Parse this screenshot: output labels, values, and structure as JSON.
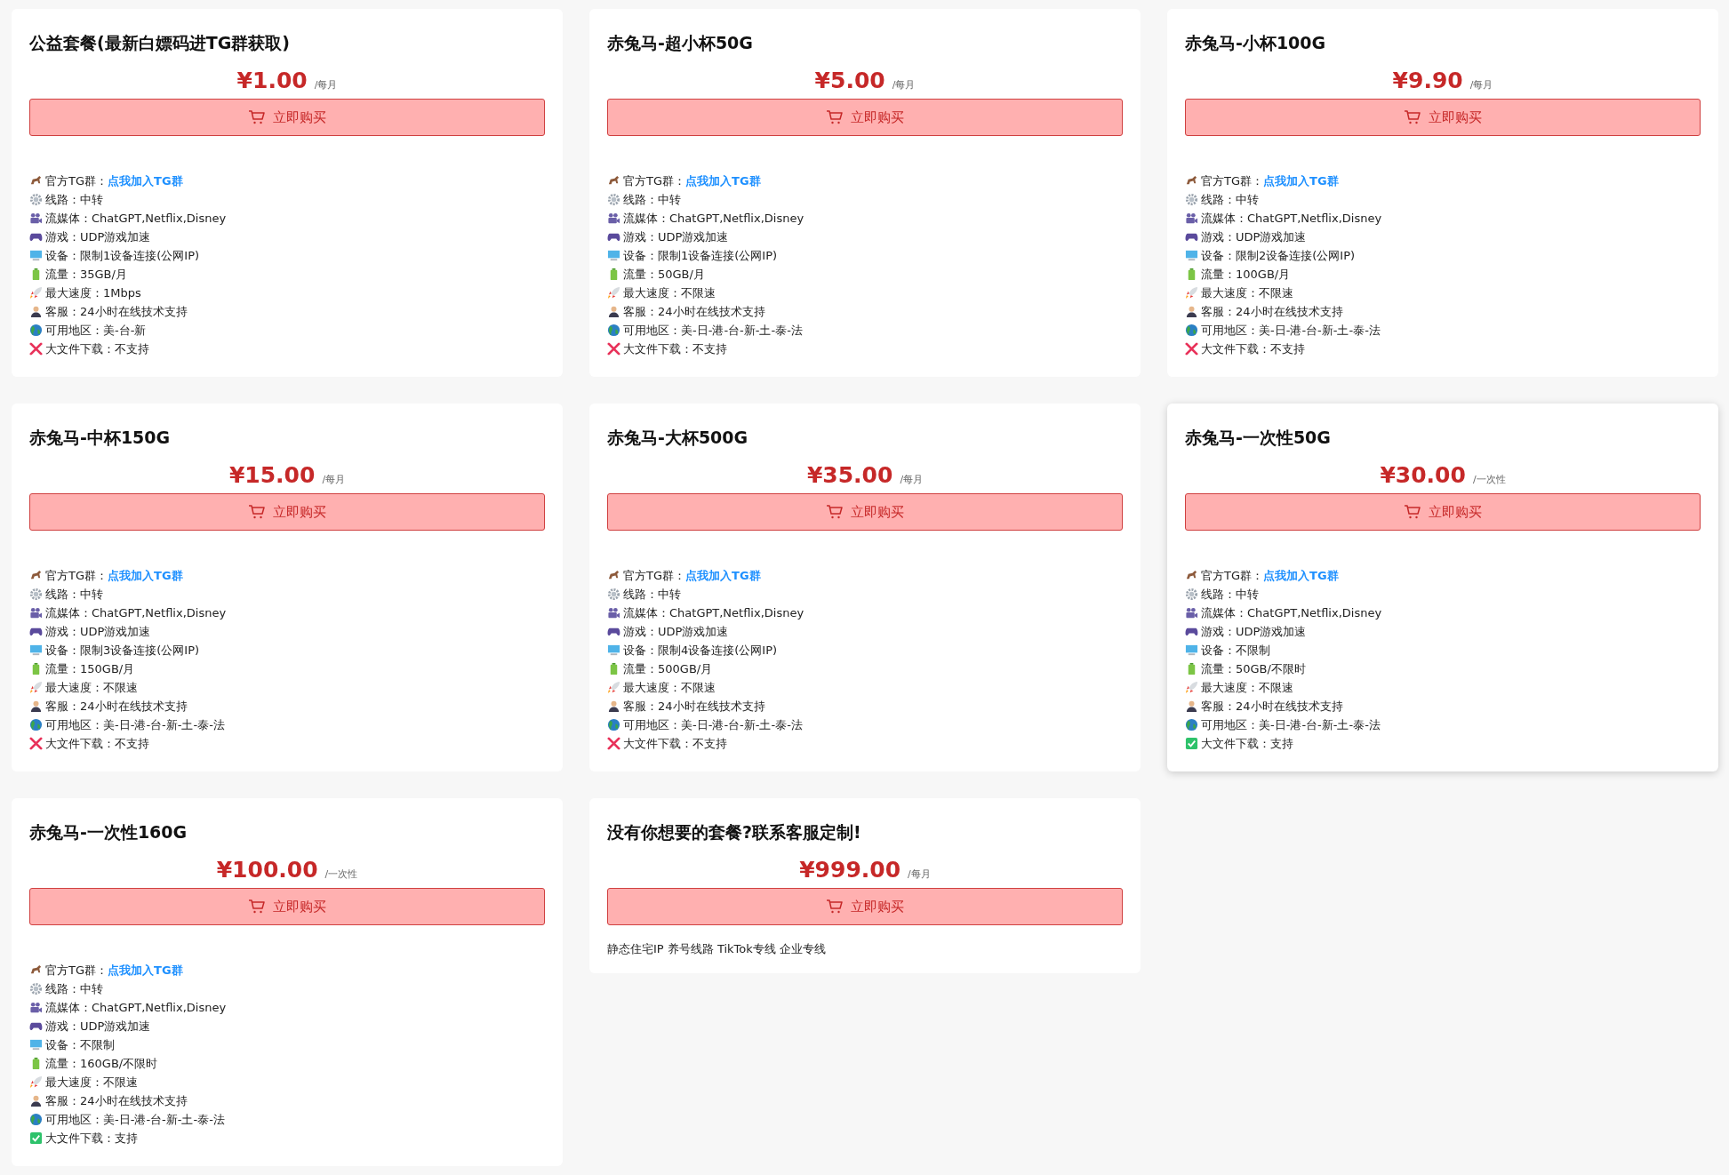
{
  "plans": [
    {
      "title": "公益套餐(最新白嫖码进TG群获取)",
      "price": "¥1.00",
      "period": "/每月",
      "button": "立即购买",
      "hovered": false,
      "features": [
        {
          "label": "官方TG群：",
          "value": "点我加入TG群",
          "kind": "link"
        },
        {
          "label": "线路：",
          "value": "中转",
          "kind": "text"
        },
        {
          "label": "流媒体：",
          "value": "ChatGPT,Netflix,Disney",
          "kind": "text"
        },
        {
          "label": "游戏：",
          "value": "UDP游戏加速",
          "kind": "text"
        },
        {
          "label": "设备：",
          "value": "限制1设备连接(公网IP)",
          "kind": "text"
        },
        {
          "label": "流量：",
          "value": "35GB/月",
          "kind": "text"
        },
        {
          "label": "最大速度：",
          "value": "1Mbps",
          "kind": "text"
        },
        {
          "label": "客服：",
          "value": "24小时在线技术支持",
          "kind": "text"
        },
        {
          "label": "可用地区：",
          "value": "美-台-新",
          "kind": "text"
        },
        {
          "label": "大文件下载：",
          "value": "不支持",
          "kind": "unsupported"
        }
      ]
    },
    {
      "title": "赤兔马-超小杯50G",
      "price": "¥5.00",
      "period": "/每月",
      "button": "立即购买",
      "hovered": false,
      "features": [
        {
          "label": "官方TG群：",
          "value": "点我加入TG群",
          "kind": "link"
        },
        {
          "label": "线路：",
          "value": "中转",
          "kind": "text"
        },
        {
          "label": "流媒体：",
          "value": "ChatGPT,Netflix,Disney",
          "kind": "text"
        },
        {
          "label": "游戏：",
          "value": "UDP游戏加速",
          "kind": "text"
        },
        {
          "label": "设备：",
          "value": "限制1设备连接(公网IP)",
          "kind": "text"
        },
        {
          "label": "流量：",
          "value": "50GB/月",
          "kind": "text"
        },
        {
          "label": "最大速度：",
          "value": "不限速",
          "kind": "text"
        },
        {
          "label": "客服：",
          "value": "24小时在线技术支持",
          "kind": "text"
        },
        {
          "label": "可用地区：",
          "value": "美-日-港-台-新-土-泰-法",
          "kind": "text"
        },
        {
          "label": "大文件下载：",
          "value": "不支持",
          "kind": "unsupported"
        }
      ]
    },
    {
      "title": "赤兔马-小杯100G",
      "price": "¥9.90",
      "period": "/每月",
      "button": "立即购买",
      "hovered": false,
      "features": [
        {
          "label": "官方TG群：",
          "value": "点我加入TG群",
          "kind": "link"
        },
        {
          "label": "线路：",
          "value": "中转",
          "kind": "text"
        },
        {
          "label": "流媒体：",
          "value": "ChatGPT,Netflix,Disney",
          "kind": "text"
        },
        {
          "label": "游戏：",
          "value": "UDP游戏加速",
          "kind": "text"
        },
        {
          "label": "设备：",
          "value": "限制2设备连接(公网IP)",
          "kind": "text"
        },
        {
          "label": "流量：",
          "value": "100GB/月",
          "kind": "text"
        },
        {
          "label": "最大速度：",
          "value": "不限速",
          "kind": "text"
        },
        {
          "label": "客服：",
          "value": "24小时在线技术支持",
          "kind": "text"
        },
        {
          "label": "可用地区：",
          "value": "美-日-港-台-新-土-泰-法",
          "kind": "text"
        },
        {
          "label": "大文件下载：",
          "value": "不支持",
          "kind": "unsupported"
        }
      ]
    },
    {
      "title": "赤兔马-中杯150G",
      "price": "¥15.00",
      "period": "/每月",
      "button": "立即购买",
      "hovered": false,
      "features": [
        {
          "label": "官方TG群：",
          "value": "点我加入TG群",
          "kind": "link"
        },
        {
          "label": "线路：",
          "value": "中转",
          "kind": "text"
        },
        {
          "label": "流媒体：",
          "value": "ChatGPT,Netflix,Disney",
          "kind": "text"
        },
        {
          "label": "游戏：",
          "value": "UDP游戏加速",
          "kind": "text"
        },
        {
          "label": "设备：",
          "value": "限制3设备连接(公网IP)",
          "kind": "text"
        },
        {
          "label": "流量：",
          "value": "150GB/月",
          "kind": "text"
        },
        {
          "label": "最大速度：",
          "value": "不限速",
          "kind": "text"
        },
        {
          "label": "客服：",
          "value": "24小时在线技术支持",
          "kind": "text"
        },
        {
          "label": "可用地区：",
          "value": "美-日-港-台-新-土-泰-法",
          "kind": "text"
        },
        {
          "label": "大文件下载：",
          "value": "不支持",
          "kind": "unsupported"
        }
      ]
    },
    {
      "title": "赤兔马-大杯500G",
      "price": "¥35.00",
      "period": "/每月",
      "button": "立即购买",
      "hovered": false,
      "features": [
        {
          "label": "官方TG群：",
          "value": "点我加入TG群",
          "kind": "link"
        },
        {
          "label": "线路：",
          "value": "中转",
          "kind": "text"
        },
        {
          "label": "流媒体：",
          "value": "ChatGPT,Netflix,Disney",
          "kind": "text"
        },
        {
          "label": "游戏：",
          "value": "UDP游戏加速",
          "kind": "text"
        },
        {
          "label": "设备：",
          "value": "限制4设备连接(公网IP)",
          "kind": "text"
        },
        {
          "label": "流量：",
          "value": "500GB/月",
          "kind": "text"
        },
        {
          "label": "最大速度：",
          "value": "不限速",
          "kind": "text"
        },
        {
          "label": "客服：",
          "value": "24小时在线技术支持",
          "kind": "text"
        },
        {
          "label": "可用地区：",
          "value": "美-日-港-台-新-土-泰-法",
          "kind": "text"
        },
        {
          "label": "大文件下载：",
          "value": "不支持",
          "kind": "unsupported"
        }
      ]
    },
    {
      "title": "赤兔马-一次性50G",
      "price": "¥30.00",
      "period": "/一次性",
      "button": "立即购买",
      "hovered": true,
      "features": [
        {
          "label": "官方TG群：",
          "value": "点我加入TG群",
          "kind": "link"
        },
        {
          "label": "线路：",
          "value": "中转",
          "kind": "text"
        },
        {
          "label": "流媒体：",
          "value": "ChatGPT,Netflix,Disney",
          "kind": "text"
        },
        {
          "label": "游戏：",
          "value": "UDP游戏加速",
          "kind": "text"
        },
        {
          "label": "设备：",
          "value": "不限制",
          "kind": "text"
        },
        {
          "label": "流量：",
          "value": "50GB/不限时",
          "kind": "text"
        },
        {
          "label": "最大速度：",
          "value": "不限速",
          "kind": "text"
        },
        {
          "label": "客服：",
          "value": "24小时在线技术支持",
          "kind": "text"
        },
        {
          "label": "可用地区：",
          "value": "美-日-港-台-新-土-泰-法",
          "kind": "text"
        },
        {
          "label": "大文件下载：",
          "value": "支持",
          "kind": "supported"
        }
      ]
    },
    {
      "title": "赤兔马-一次性160G",
      "price": "¥100.00",
      "period": "/一次性",
      "button": "立即购买",
      "hovered": false,
      "features": [
        {
          "label": "官方TG群：",
          "value": "点我加入TG群",
          "kind": "link"
        },
        {
          "label": "线路：",
          "value": "中转",
          "kind": "text"
        },
        {
          "label": "流媒体：",
          "value": "ChatGPT,Netflix,Disney",
          "kind": "text"
        },
        {
          "label": "游戏：",
          "value": "UDP游戏加速",
          "kind": "text"
        },
        {
          "label": "设备：",
          "value": "不限制",
          "kind": "text"
        },
        {
          "label": "流量：",
          "value": "160GB/不限时",
          "kind": "text"
        },
        {
          "label": "最大速度：",
          "value": "不限速",
          "kind": "text"
        },
        {
          "label": "客服：",
          "value": "24小时在线技术支持",
          "kind": "text"
        },
        {
          "label": "可用地区：",
          "value": "美-日-港-台-新-土-泰-法",
          "kind": "text"
        },
        {
          "label": "大文件下载：",
          "value": "支持",
          "kind": "supported"
        }
      ]
    },
    {
      "title": "没有你想要的套餐?联系客服定制!",
      "price": "¥999.00",
      "period": "/每月",
      "button": "立即购买",
      "hovered": false,
      "description": "静态住宅IP 养号线路 TikTok专线 企业专线"
    }
  ]
}
